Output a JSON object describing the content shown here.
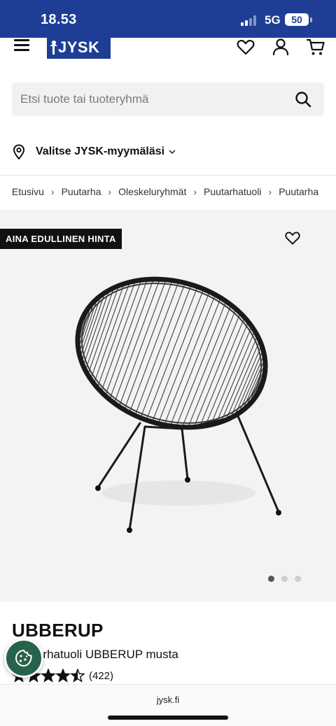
{
  "status_bar": {
    "time": "18.53",
    "network": "5G",
    "battery": "50"
  },
  "header": {
    "logo_text": "JYSK",
    "icons": [
      "menu-icon",
      "heart-icon",
      "user-icon",
      "cart-icon"
    ]
  },
  "search": {
    "placeholder": "Etsi tuote tai tuoteryhmä",
    "value": ""
  },
  "store": {
    "label": "Valitse JYSK-myymäläsi"
  },
  "breadcrumb": [
    "Etusivu",
    "Puutarha",
    "Oleskeluryhmät",
    "Puutarhatuoli",
    "Puutarha"
  ],
  "product": {
    "badge": "AINA EDULLINEN HINTA",
    "name": "UBBERUP",
    "description": "Puutarhatuoli UBBERUP musta",
    "rating": 4.5,
    "rating_count": "(422)",
    "image_count": 3,
    "active_image": 1
  },
  "browser": {
    "url": "jysk.fi"
  },
  "colors": {
    "brand": "#1e3d94",
    "cookie_button": "#27634b",
    "badge_bg": "#111111"
  }
}
